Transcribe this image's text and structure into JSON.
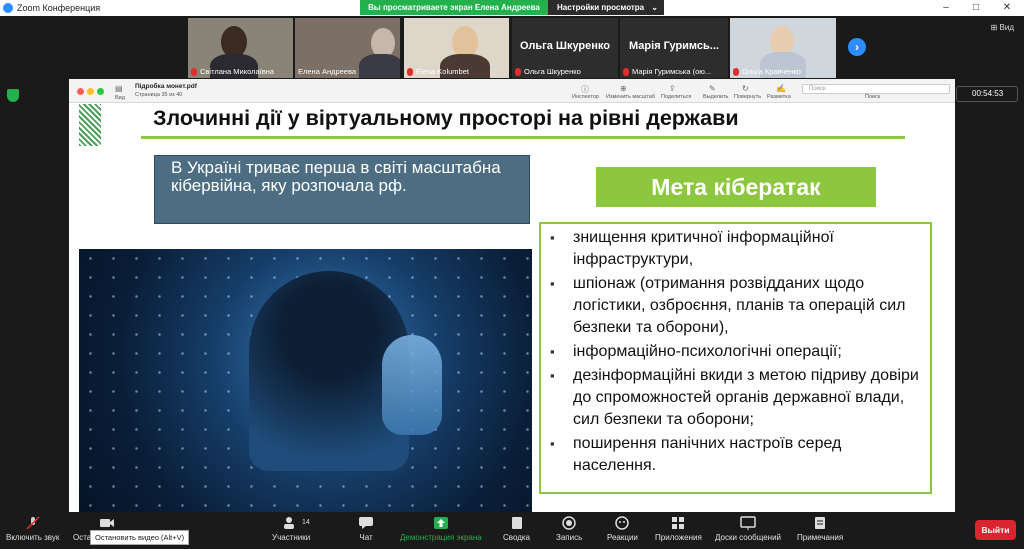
{
  "window": {
    "title": "Zoom Конференция",
    "controls": {
      "minimize": "–",
      "maximize": "□",
      "close": "✕"
    }
  },
  "banner": {
    "sharing_text": "Вы просматриваете экран Елена Андреева",
    "view_settings": "Настройки просмотра",
    "chevron": "⌄"
  },
  "participants": [
    {
      "name": "Світлана Миколаївна",
      "muted": true
    },
    {
      "name": "Елена Андреева",
      "muted": false
    },
    {
      "name": "Elena Kolumbet",
      "muted": true
    },
    {
      "name": "Ольга Шкуренко",
      "muted": true,
      "display": "Ольга Шкуренко"
    },
    {
      "name": "Марія Гуримська (ою...",
      "muted": true,
      "display": "Марія Гуримсь..."
    },
    {
      "name": "Ольга Кравченко",
      "muted": true
    }
  ],
  "strip": {
    "next": "›",
    "view_label": "Вид"
  },
  "timer": "00:54:53",
  "pdf_viewer": {
    "file_name": "Підробка монет.pdf",
    "page_info": "Страница 35 из 40",
    "view_label": "Вид",
    "tools": [
      "Инспектор",
      "Изменить масштаб",
      "Поделиться",
      "Выделить",
      "Повернуть",
      "Разметка"
    ],
    "search_placeholder": "Поиск",
    "search_label": "Поиск"
  },
  "slide": {
    "title": "Злочинні дії у віртуальному просторі на рівні держави",
    "intro": "В Україні триває перша в світі масштабна кібервійна, яку розпочала рф.",
    "goal_heading": "Мета кібератак",
    "bullets": [
      "знищення критичної інформаційної інфраструктури,",
      "шпіонаж (отримання розвідданих щодо логістики, озброєння, планів та операцій сил безпеки та оборони),",
      "інформаційно-психологічні операції;",
      "дезінформаційні вкиди з метою підриву довіри до спроможностей органів державної влади, сил безпеки та оборони;",
      "поширення панічних настроїв серед населення."
    ]
  },
  "toolbar": {
    "unmute": "Включить звук",
    "stop_video": "Остановить видео",
    "tooltip": "Остановить видео (Alt+V)",
    "participants": "Участники",
    "participants_count": "14",
    "chat": "Чат",
    "share": "Демонстрация экрана",
    "reactions_label": "Реакции",
    "record": "Запись",
    "whiteboards": "Сводка",
    "apps": "Приложения",
    "whiteboard_msgs": "Доски сообщений",
    "notes": "Примечания",
    "leave": "Выйти"
  },
  "colors": {
    "zoom_blue": "#2d8cff",
    "share_green": "#23b14d",
    "slide_green": "#8dc63f",
    "intro_box": "#4d6e82",
    "leave_red": "#d9252f"
  }
}
